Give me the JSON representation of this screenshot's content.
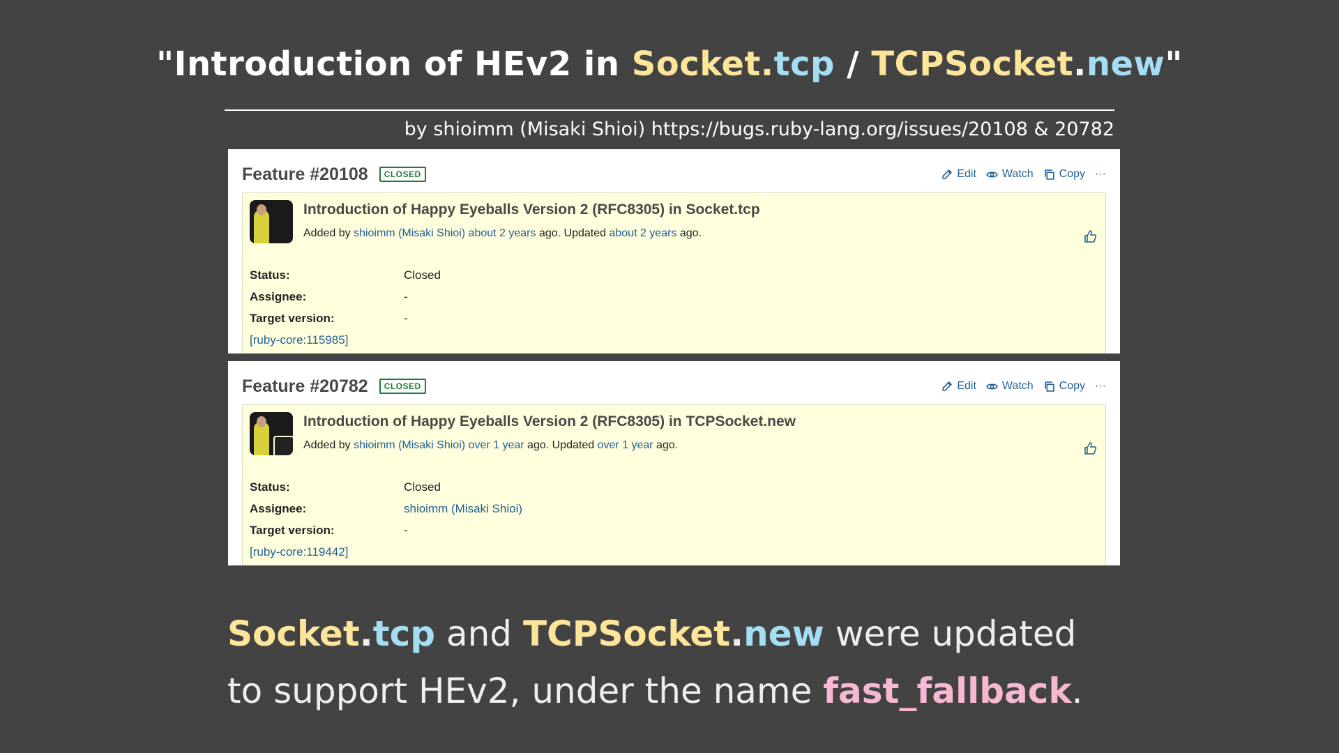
{
  "title": {
    "prefix": "\"Introduction of HEv2 in ",
    "socket": "Socket",
    "dot1": ".",
    "tcp": "tcp",
    "slash": " / ",
    "tcpsocket": "TCPSocket",
    "dot2": ".",
    "new": "new",
    "suffix": "\""
  },
  "byline": "by shioimm (Misaki Shioi) https://bugs.ruby-lang.org/issues/20108 & 20782",
  "actions": {
    "edit": "Edit",
    "watch": "Watch",
    "copy": "Copy",
    "more": "···"
  },
  "cards": [
    {
      "feature": "Feature #20108",
      "badge": "CLOSED",
      "subject": "Introduction of Happy Eyeballs Version 2 (RFC8305) in Socket.tcp",
      "added_prefix": "Added by ",
      "author": "shioimm (Misaki Shioi)",
      "added_time": "about 2 years",
      "updated_prefix": " ago. Updated ",
      "updated_time": "about 2 years",
      "suffix": " ago.",
      "status_label": "Status:",
      "status": "Closed",
      "assignee_label": "Assignee:",
      "assignee": "-",
      "target_label": "Target version:",
      "target": "-",
      "ref": "[ruby-core:115985]"
    },
    {
      "feature": "Feature #20782",
      "badge": "CLOSED",
      "subject": "Introduction of Happy Eyeballs Version 2 (RFC8305) in TCPSocket.new",
      "added_prefix": "Added by ",
      "author": "shioimm (Misaki Shioi)",
      "added_time": "over 1 year",
      "updated_prefix": " ago. Updated ",
      "updated_time": "over 1 year",
      "suffix": " ago.",
      "status_label": "Status:",
      "status": "Closed",
      "assignee_label": "Assignee:",
      "assignee": "shioimm (Misaki Shioi)",
      "target_label": "Target version:",
      "target": "-",
      "ref": "[ruby-core:119442]"
    }
  ],
  "summary": {
    "line1": {
      "socket": "Socket",
      "dot1": ".",
      "tcp": "tcp",
      "and": " and ",
      "tcpsocket": "TCPSocket",
      "dot2": ".",
      "new": "new",
      "rest": " were updated"
    },
    "line2": {
      "prefix": "to support HEv2, under the name ",
      "name": "fast_fallback",
      "period": "."
    }
  },
  "colors": {
    "background": "#434343",
    "yellow": "#fde599",
    "cyan": "#a4def3",
    "pink": "#f7b8d3",
    "link": "#1f5f95",
    "issue_bg": "#ffffdd"
  }
}
